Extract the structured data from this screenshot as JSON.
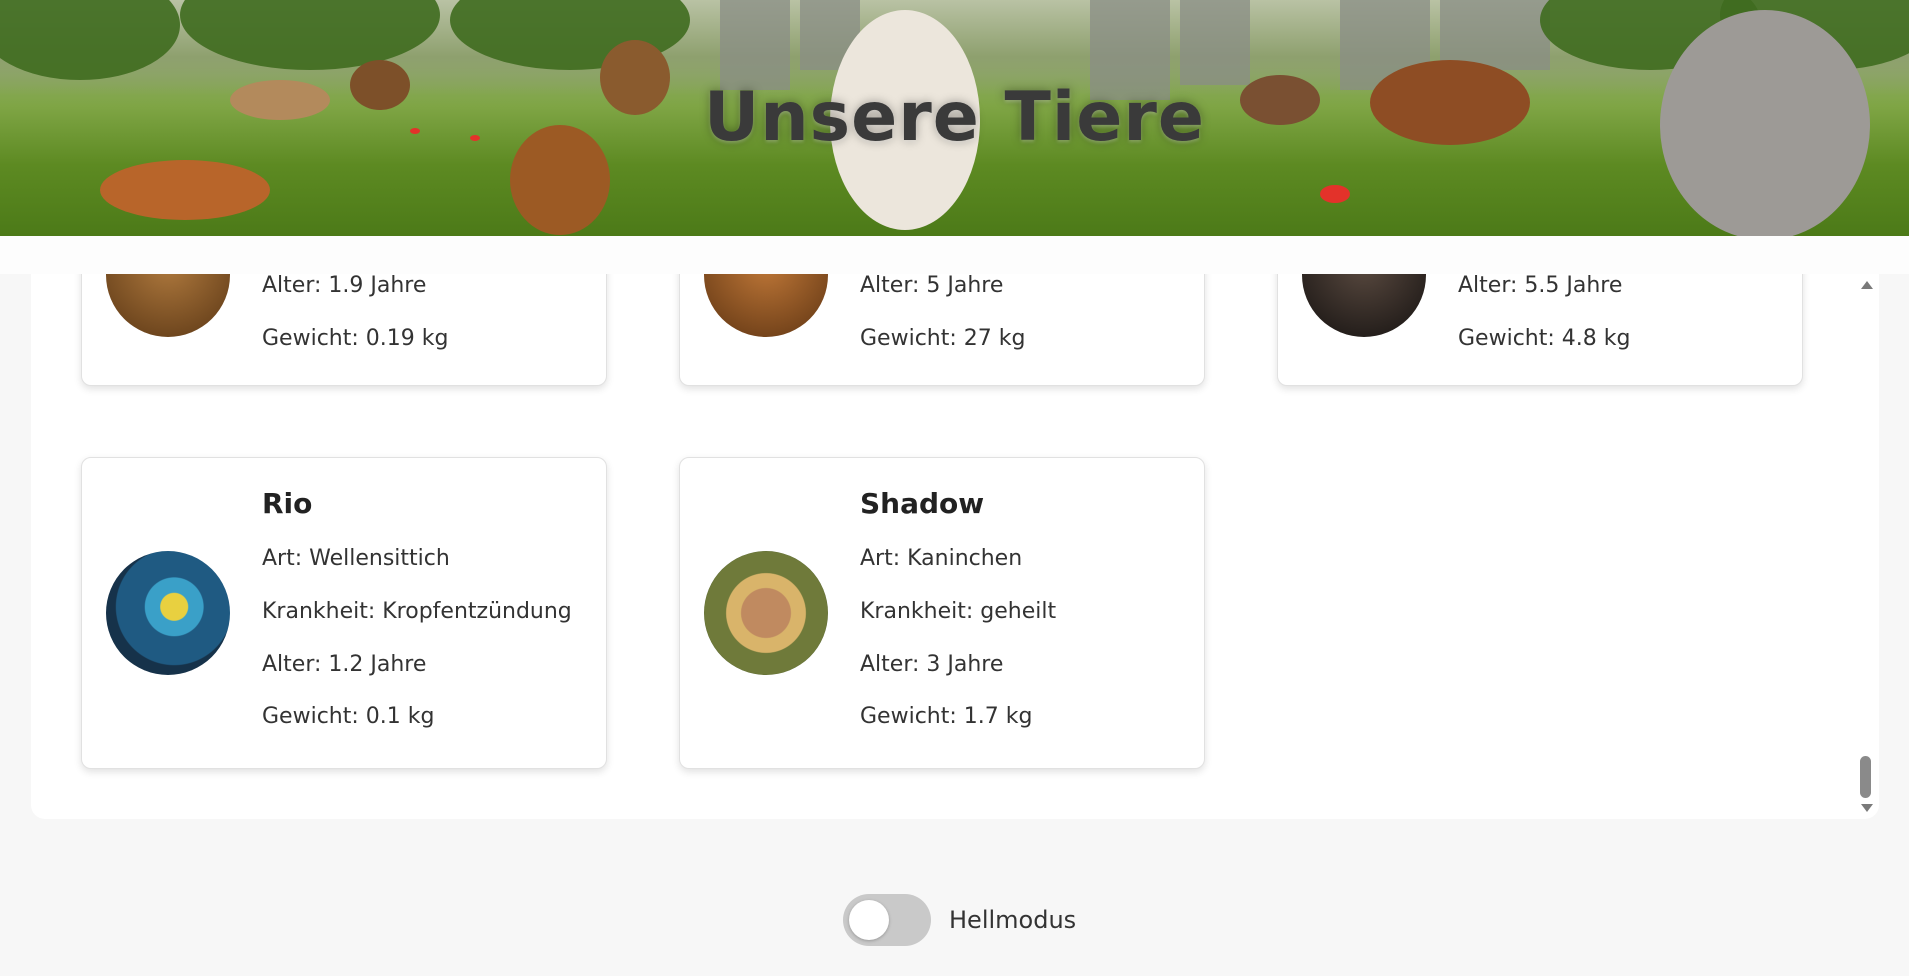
{
  "header": {
    "title": "Unsere Tiere"
  },
  "top_cards": [
    {
      "alter": "Alter: 1.9 Jahre",
      "gewicht": "Gewicht: 0.19 kg",
      "avatar_color": "#8a5a2a"
    },
    {
      "alter": "Alter: 5 Jahre",
      "gewicht": "Gewicht: 27 kg",
      "avatar_color": "#9a5a22"
    },
    {
      "alter": "Alter: 5.5 Jahre",
      "gewicht": "Gewicht: 4.8 kg",
      "avatar_color": "#2a2522"
    }
  ],
  "cards": [
    {
      "name": "Rio",
      "art": "Art: Wellensittich",
      "krankheit": "Krankheit: Kropfentzündung",
      "alter": "Alter: 1.2 Jahre",
      "gewicht": "Gewicht: 0.1 kg",
      "avatar": "parakeet-avatar"
    },
    {
      "name": "Shadow",
      "art": "Art: Kaninchen",
      "krankheit": "Krankheit: geheilt",
      "alter": "Alter: 3 Jahre",
      "gewicht": "Gewicht: 1.7 kg",
      "avatar": "rabbit-avatar"
    }
  ],
  "theme_toggle": {
    "label": "Hellmodus",
    "on": false
  },
  "colors": {
    "background": "#f7f7f7",
    "card": "#ffffff",
    "toggle_track": "#c9c9c9"
  }
}
